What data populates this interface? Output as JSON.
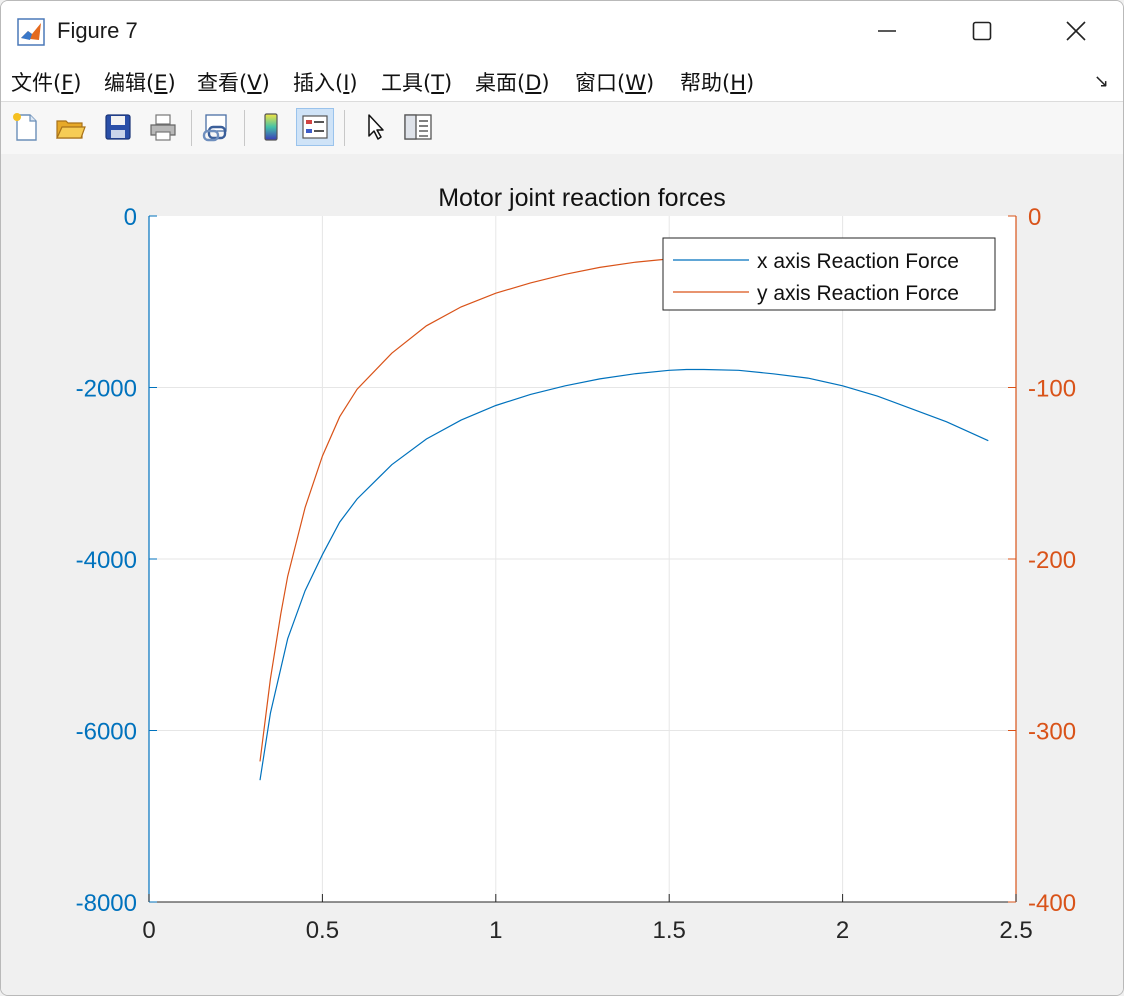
{
  "window": {
    "title": "Figure 7",
    "controls": [
      "minimize",
      "maximize",
      "close"
    ]
  },
  "menu": [
    {
      "label": "文件(",
      "key": "F",
      "tail": ")"
    },
    {
      "label": "编辑(",
      "key": "E",
      "tail": ")"
    },
    {
      "label": "查看(",
      "key": "V",
      "tail": ")"
    },
    {
      "label": "插入(",
      "key": "I",
      "tail": ")"
    },
    {
      "label": "工具(",
      "key": "T",
      "tail": ")"
    },
    {
      "label": "桌面(",
      "key": "D",
      "tail": ")"
    },
    {
      "label": "窗口(",
      "key": "W",
      "tail": ")"
    },
    {
      "label": "帮助(",
      "key": "H",
      "tail": ")"
    }
  ],
  "toolbar": {
    "icons": [
      "new-figure-icon",
      "open-file-icon",
      "save-icon",
      "print-icon",
      "link-plot-icon",
      "colorbar-icon",
      "legend-icon",
      "pointer-icon",
      "property-inspector-icon"
    ]
  },
  "colors": {
    "left_axis": "#0072BD",
    "right_axis": "#D95319",
    "grid": "#e6e6e6"
  },
  "chart_data": {
    "type": "line",
    "title": "Motor joint reaction forces",
    "xlim": [
      0,
      2.5
    ],
    "xticks": [
      "0",
      "0.5",
      "1",
      "1.5",
      "2",
      "2.5"
    ],
    "xtick_values": [
      0,
      0.5,
      1,
      1.5,
      2,
      2.5
    ],
    "ylim_left": [
      -8000,
      0
    ],
    "yticks_left": [
      "0",
      "-2000",
      "-4000",
      "-6000",
      "-8000"
    ],
    "ytick_values_left": [
      0,
      -2000,
      -4000,
      -6000,
      -8000
    ],
    "ylim_right": [
      -400,
      0
    ],
    "yticks_right": [
      "0",
      "-100",
      "-200",
      "-300",
      "-400"
    ],
    "ytick_values_right": [
      0,
      -100,
      -200,
      -300,
      -400
    ],
    "grid": true,
    "legend_position": "top-right",
    "series": [
      {
        "name": "x axis Reaction Force",
        "axis": "left",
        "color": "#0072BD",
        "x": [
          0.32,
          0.35,
          0.4,
          0.45,
          0.5,
          0.55,
          0.6,
          0.7,
          0.8,
          0.9,
          1.0,
          1.1,
          1.2,
          1.3,
          1.4,
          1.5,
          1.55,
          1.6,
          1.7,
          1.8,
          1.9,
          2.0,
          2.1,
          2.2,
          2.3,
          2.42
        ],
        "y": [
          -6580,
          -5800,
          -4930,
          -4370,
          -3950,
          -3570,
          -3300,
          -2900,
          -2600,
          -2380,
          -2210,
          -2080,
          -1980,
          -1900,
          -1840,
          -1800,
          -1790,
          -1790,
          -1800,
          -1840,
          -1890,
          -1980,
          -2100,
          -2250,
          -2400,
          -2620
        ]
      },
      {
        "name": "y axis Reaction Force",
        "axis": "right",
        "color": "#D95319",
        "x": [
          0.32,
          0.35,
          0.38,
          0.4,
          0.45,
          0.5,
          0.55,
          0.6,
          0.7,
          0.8,
          0.9,
          1.0,
          1.1,
          1.2,
          1.3,
          1.4,
          1.5,
          1.6,
          1.7,
          1.8,
          1.9,
          2.0,
          2.1,
          2.2,
          2.3,
          2.42
        ],
        "y": [
          -318,
          -270,
          -232,
          -210,
          -170,
          -140,
          -117,
          -101,
          -80,
          -64,
          -53,
          -45,
          -39,
          -34,
          -30,
          -27,
          -25,
          -23,
          -21,
          -20,
          -19,
          -18,
          -17,
          -16,
          -15,
          -14
        ]
      }
    ]
  }
}
